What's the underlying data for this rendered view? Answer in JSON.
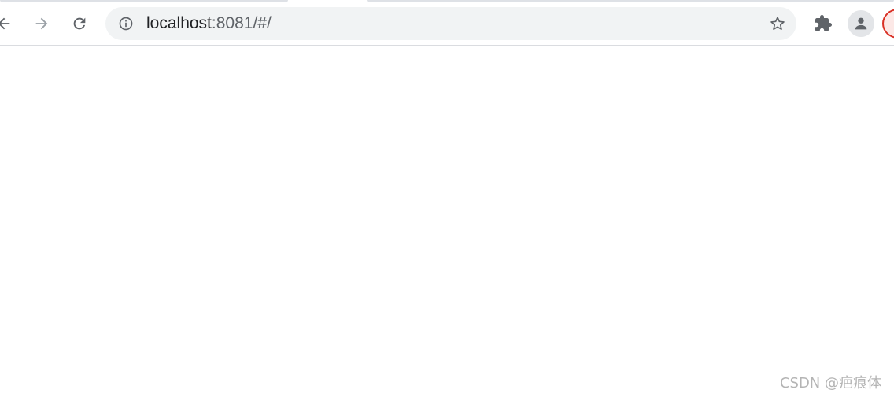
{
  "address_bar": {
    "url_host": "localhost",
    "url_rest": ":8081/#/"
  },
  "icons": {
    "back": "arrow-left-icon",
    "forward": "arrow-right-icon",
    "reload": "reload-icon",
    "site_info": "info-icon",
    "bookmark": "star-icon",
    "extensions": "puzzle-icon",
    "profile": "person-icon"
  },
  "colors": {
    "omnibox_bg": "#f1f3f4",
    "icon_dark": "#5f6368",
    "icon_disabled": "#9aa0a6",
    "profile_badge_border": "#d93025"
  },
  "watermark": {
    "text": "CSDN @疤痕体"
  }
}
